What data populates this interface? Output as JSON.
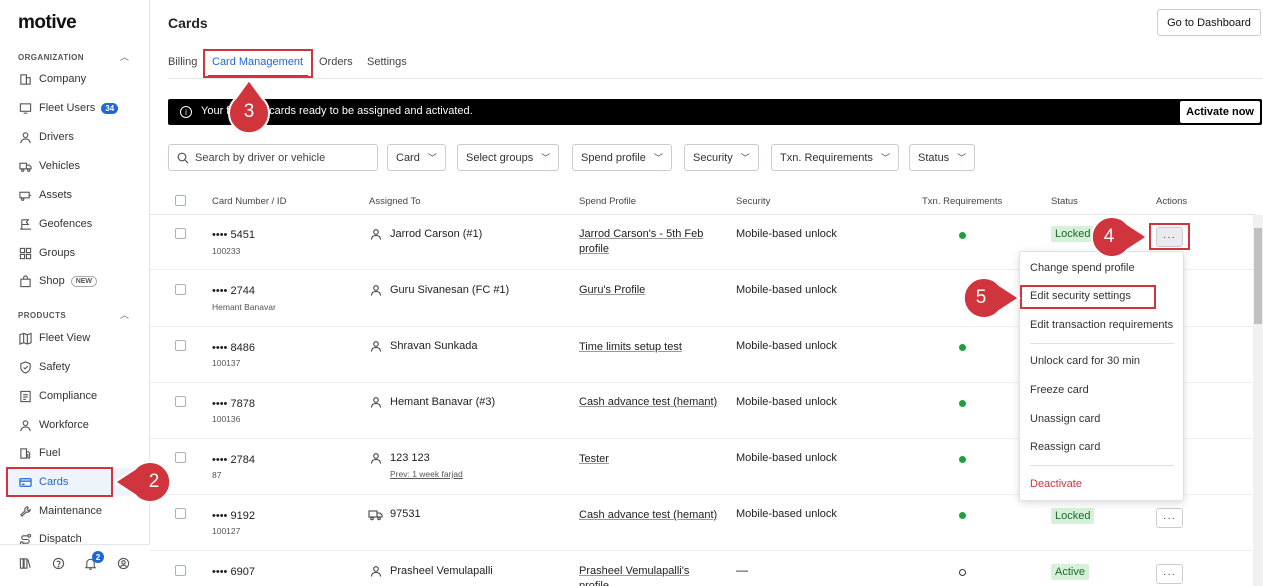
{
  "brand": {
    "logo": "motive"
  },
  "sidebar": {
    "organization_heading": "ORGANIZATION",
    "products_heading": "PRODUCTS",
    "org_items": [
      {
        "label": "Company"
      },
      {
        "label": "Fleet Users",
        "badge": "34"
      },
      {
        "label": "Drivers"
      },
      {
        "label": "Vehicles"
      },
      {
        "label": "Assets"
      },
      {
        "label": "Geofences"
      },
      {
        "label": "Groups"
      },
      {
        "label": "Shop",
        "pill": "NEW"
      }
    ],
    "product_items": [
      {
        "label": "Fleet View"
      },
      {
        "label": "Safety"
      },
      {
        "label": "Compliance"
      },
      {
        "label": "Workforce"
      },
      {
        "label": "Fuel"
      },
      {
        "label": "Cards"
      },
      {
        "label": "Maintenance"
      },
      {
        "label": "Dispatch"
      }
    ],
    "notification_count": "2"
  },
  "header": {
    "title": "Cards",
    "dashboard_button": "Go to Dashboard"
  },
  "tabs": [
    {
      "label": "Billing"
    },
    {
      "label": "Card Management"
    },
    {
      "label": "Orders"
    },
    {
      "label": "Settings"
    }
  ],
  "banner": {
    "text": "Your f        52 cards ready to be assigned and activated.",
    "button": "Activate now"
  },
  "filters": {
    "search_placeholder": "Search by driver or vehicle",
    "dropdowns": [
      "Card",
      "Select groups",
      "Spend profile",
      "Security",
      "Txn. Requirements",
      "Status"
    ]
  },
  "table": {
    "columns": [
      "Card Number / ID",
      "Assigned To",
      "Spend Profile",
      "Security",
      "Txn. Requirements",
      "Status",
      "Actions"
    ],
    "rows": [
      {
        "card": "•••• 5451",
        "id": "100233",
        "assigned": "Jarrod Carson (#1)",
        "assigned_sub": "",
        "spend": "Jarrod Carson's - 5th Feb profile",
        "security": "Mobile-based unlock",
        "txn": "green",
        "status": "Locked"
      },
      {
        "card": "•••• 2744",
        "id": "Hemant Banavar",
        "assigned": "Guru Sivanesan (FC #1)",
        "assigned_sub": "",
        "spend": "Guru's Profile",
        "security": "Mobile-based unlock",
        "txn": "",
        "status": ""
      },
      {
        "card": "•••• 8486",
        "id": "100137",
        "assigned": "Shravan Sunkada",
        "assigned_sub": "",
        "spend": "Time limits setup test",
        "security": "Mobile-based unlock",
        "txn": "green",
        "status": ""
      },
      {
        "card": "•••• 7878",
        "id": "100136",
        "assigned": "Hemant Banavar (#3)",
        "assigned_sub": "",
        "spend": "Cash advance test (hemant)",
        "security": "Mobile-based unlock",
        "txn": "green",
        "status": ""
      },
      {
        "card": "•••• 2784",
        "id": "87",
        "assigned": "123 123",
        "assigned_sub": "Prev: 1 week farjad",
        "spend": "Tester",
        "security": "Mobile-based unlock",
        "txn": "green",
        "status": ""
      },
      {
        "card": "•••• 9192",
        "id": "100127",
        "assigned": "97531",
        "assigned_sub": "",
        "spend": "Cash advance test (hemant)",
        "security": "Mobile-based unlock",
        "txn": "green",
        "status": "Locked"
      },
      {
        "card": "•••• 6907",
        "id": "",
        "assigned": "Prasheel Vemulapalli",
        "assigned_sub": "",
        "spend": "Prasheel Vemulapalli's profile",
        "security": "—",
        "txn": "hollow",
        "status": "Active"
      }
    ]
  },
  "actions_menu": {
    "items": [
      "Change spend profile",
      "Edit security settings",
      "Edit transaction requirements",
      "Unlock card for 30 min",
      "Freeze card",
      "Unassign card",
      "Reassign card",
      "Deactivate"
    ]
  },
  "annotations": [
    "2",
    "3",
    "4",
    "5"
  ],
  "colors": {
    "accent": "#1e67d5",
    "highlight": "#d0343c",
    "success_bg": "#d5f1d8"
  }
}
